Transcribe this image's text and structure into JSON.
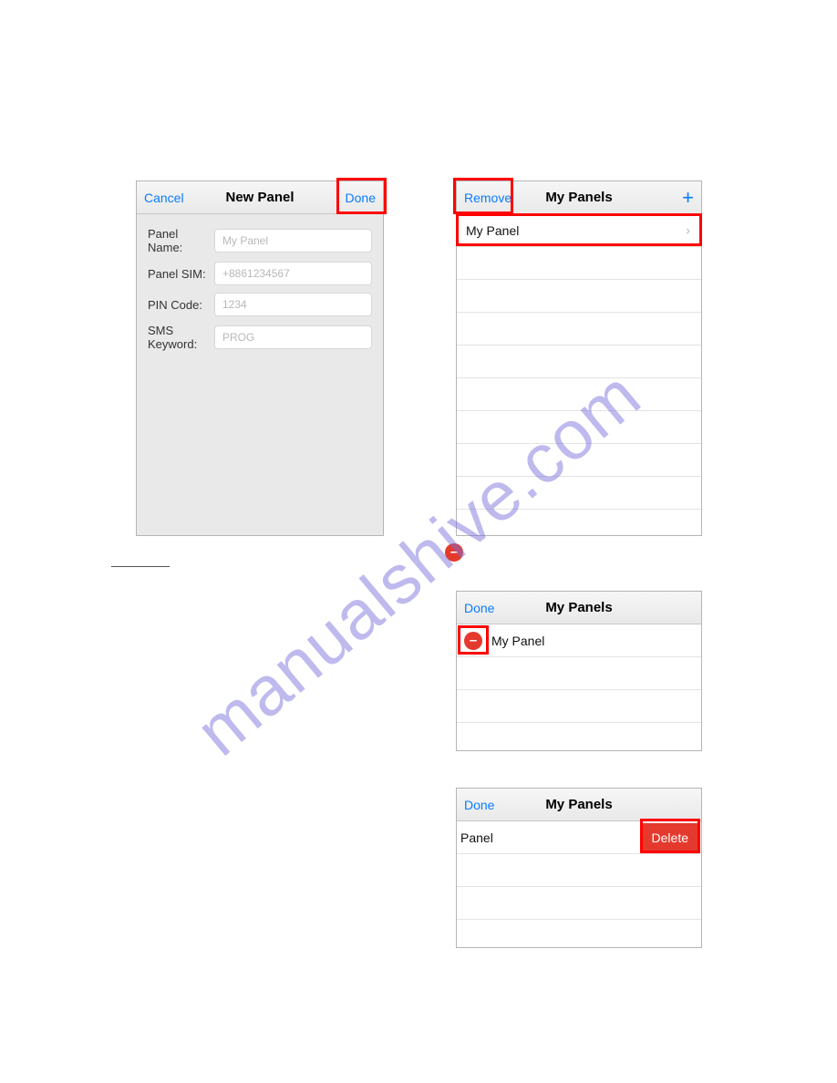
{
  "watermark": "manualshive.com",
  "newPanel": {
    "cancel": "Cancel",
    "title": "New Panel",
    "done": "Done",
    "fields": {
      "panelName": {
        "label": "Panel Name:",
        "placeholder": "My Panel"
      },
      "panelSIM": {
        "label": "Panel SIM:",
        "placeholder": "+8861234567"
      },
      "pinCode": {
        "label": "PIN Code:",
        "placeholder": "1234"
      },
      "smsKeyword": {
        "label": "SMS Keyword:",
        "placeholder": "PROG"
      }
    }
  },
  "myPanels1": {
    "remove": "Remove",
    "title": "My Panels",
    "row0": "My Panel"
  },
  "myPanels2": {
    "done": "Done",
    "title": "My Panels",
    "row0": "My Panel"
  },
  "myPanels3": {
    "done": "Done",
    "title": "My Panels",
    "row0": "Panel",
    "delete": "Delete"
  }
}
